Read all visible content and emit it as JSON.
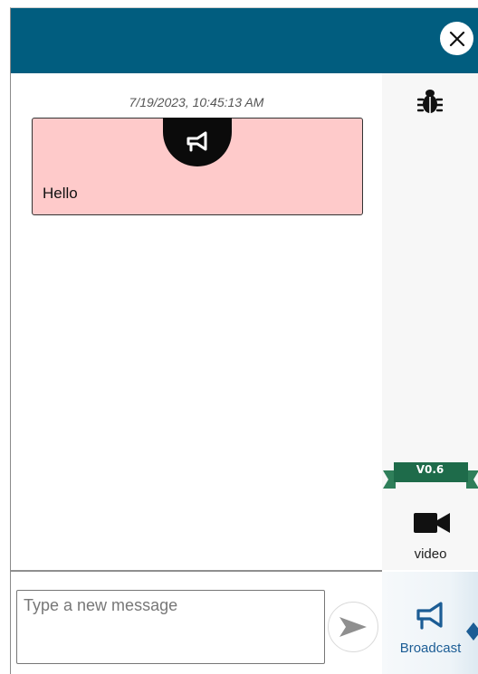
{
  "header": {
    "close_icon": "close-icon"
  },
  "chat": {
    "messages": [
      {
        "timestamp": "7/19/2023, 10:45:13 AM",
        "type_icon": "megaphone-icon",
        "text": "Hello",
        "background": "#fecaca"
      }
    ]
  },
  "side_rail": {
    "debug_icon": "bug-icon",
    "version": "V0.6",
    "video": {
      "icon": "video-camera-icon",
      "label": "video"
    }
  },
  "composer": {
    "placeholder": "Type a new message",
    "value": "",
    "send_icon": "send-arrow-icon"
  },
  "tabs": [
    {
      "label": "Broadcast",
      "icon": "megaphone-icon",
      "active": true
    }
  ],
  "colors": {
    "header": "#015d7f",
    "message_bg": "#fecaca",
    "ribbon": "#1e6b4a",
    "tab_accent": "#1c5d95"
  }
}
